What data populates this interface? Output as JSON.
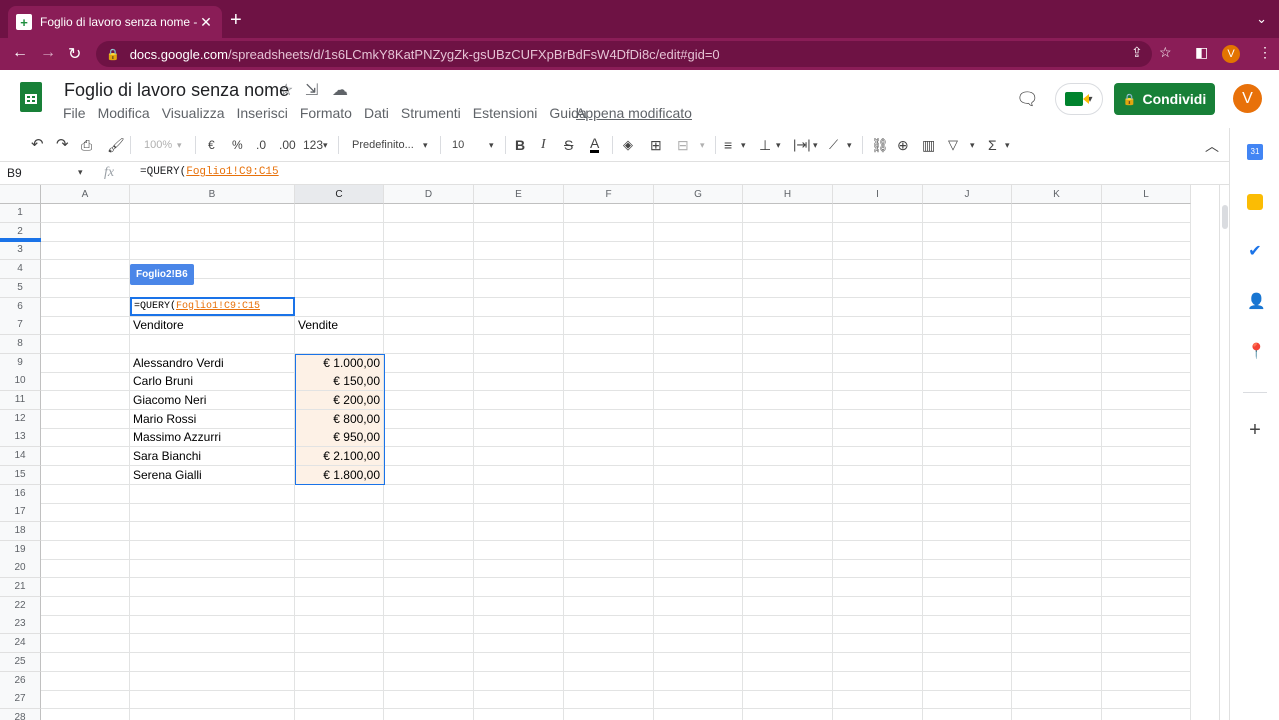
{
  "browser": {
    "tab_title": "Foglio di lavoro senza nome - F",
    "url_host": "docs.google.com",
    "url_path": "/spreadsheets/d/1s6LCmkY8KatPNZygZk-gsUBzCUFXpBrBdFsW4DfDi8c/edit#gid=0",
    "profile_initial": "V"
  },
  "header": {
    "doc_title": "Foglio di lavoro senza nome",
    "menus": [
      "File",
      "Modifica",
      "Visualizza",
      "Inserisci",
      "Formato",
      "Dati",
      "Strumenti",
      "Estensioni",
      "Guida"
    ],
    "last_edit": "Appena modificato",
    "share_label": "Condividi",
    "avatar_initial": "V"
  },
  "toolbar": {
    "zoom": "100%",
    "currency": "€",
    "percent": "%",
    "dec_decrease": ".0",
    "dec_increase": ".00",
    "more_formats": "123",
    "font": "Predefinito...",
    "font_size": "10"
  },
  "formula_bar": {
    "name_box": "B9",
    "formula_prefix": "=QUERY(",
    "formula_ref": "Foglio1!C9:C15"
  },
  "grid": {
    "columns": [
      "A",
      "B",
      "C",
      "D",
      "E",
      "F",
      "G",
      "H",
      "I",
      "J",
      "K",
      "L"
    ],
    "rows": [
      "1",
      "2",
      "3",
      "4",
      "5",
      "6",
      "7",
      "8",
      "9",
      "10",
      "11",
      "12",
      "13",
      "14",
      "15",
      "16",
      "17",
      "18",
      "19",
      "20",
      "21",
      "22",
      "23",
      "24",
      "25",
      "26",
      "27",
      "28"
    ],
    "ref_tooltip": "Foglio2!B6",
    "edit_prefix": "=QUERY(",
    "edit_ref": "Foglio1!C9:C15",
    "header_venditore": "Venditore",
    "header_vendite": "Vendite",
    "records": [
      {
        "name": "Alessandro Verdi",
        "value": "€ 1.000,00"
      },
      {
        "name": "Carlo Bruni",
        "value": "€ 150,00"
      },
      {
        "name": "Giacomo Neri",
        "value": "€ 200,00"
      },
      {
        "name": "Mario Rossi",
        "value": "€ 800,00"
      },
      {
        "name": "Massimo Azzurri",
        "value": "€ 950,00"
      },
      {
        "name": "Sara Bianchi",
        "value": "€ 2.100,00"
      },
      {
        "name": "Serena Gialli",
        "value": "€ 1.800,00"
      }
    ]
  },
  "colors": {
    "browser_frame": "#6e1244",
    "sheets_green": "#188038",
    "selection_blue": "#1a73e8",
    "ref_orange": "#e8710a"
  }
}
